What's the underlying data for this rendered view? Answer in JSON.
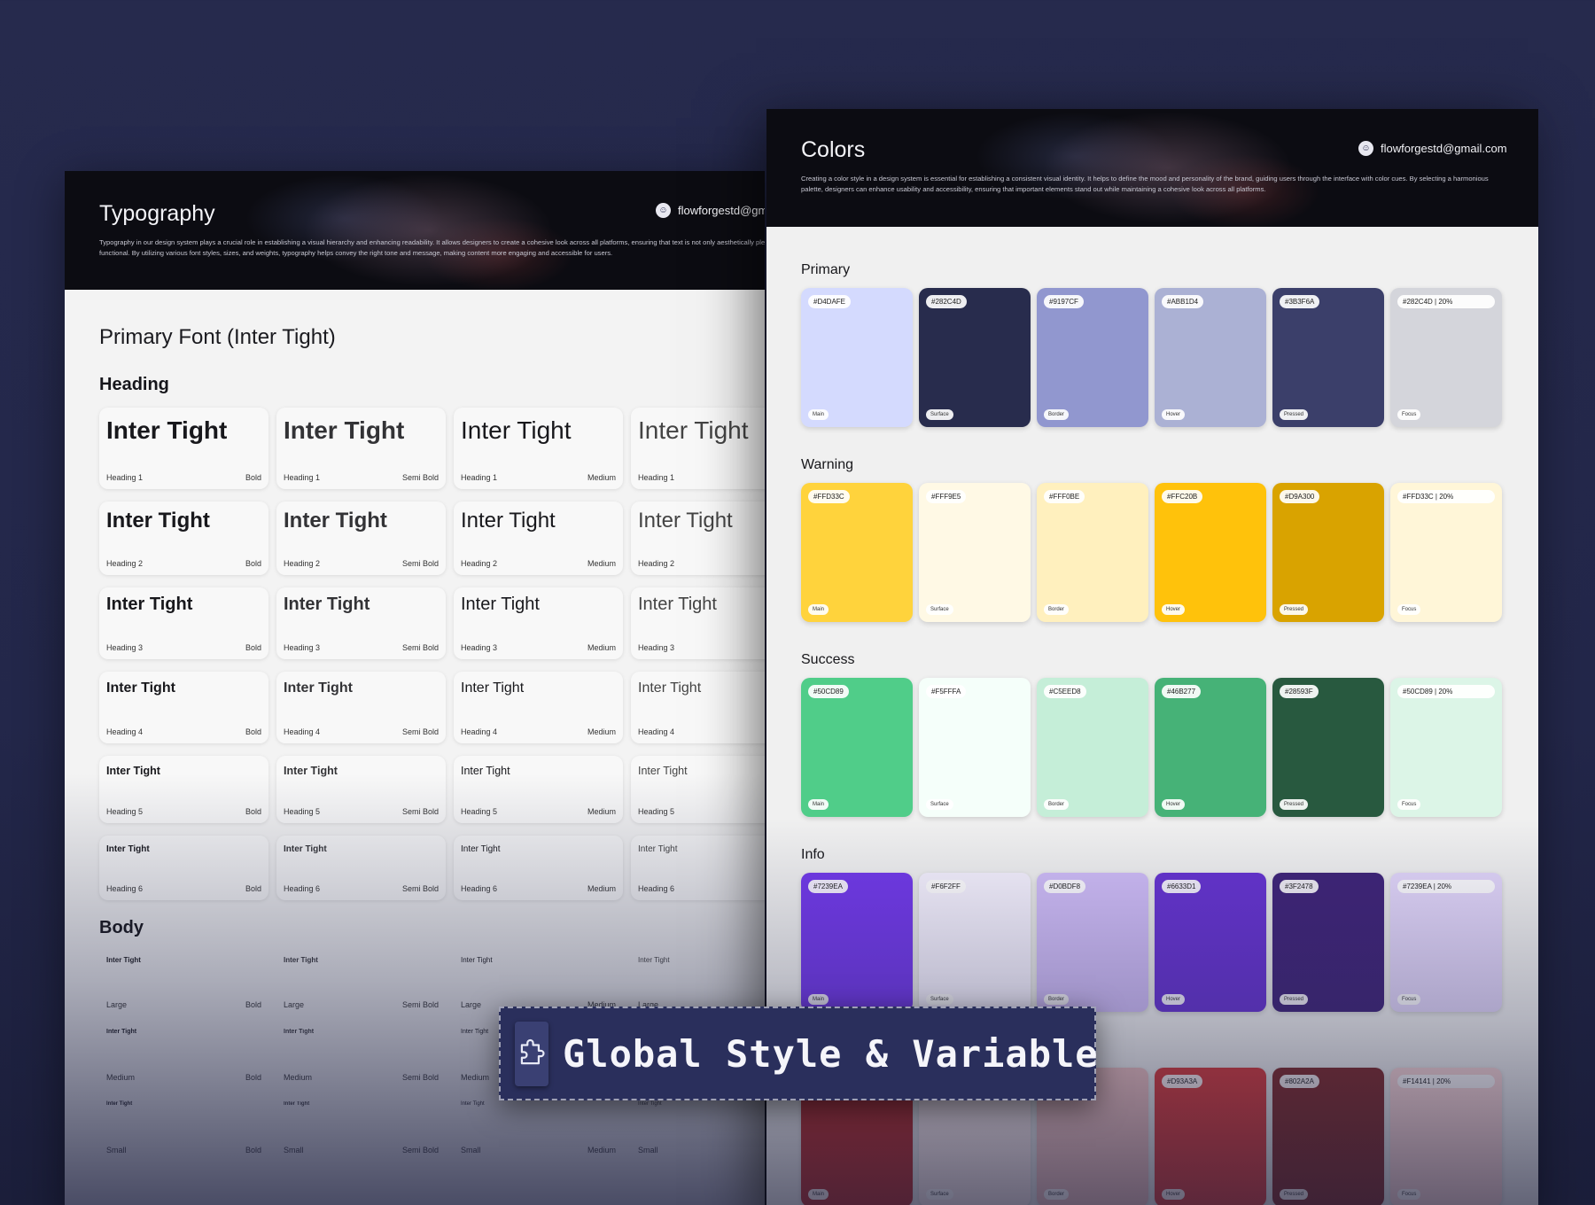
{
  "typography": {
    "title": "Typography",
    "email": "flowforgestd@gmail.com",
    "description": "Typography in our design system plays a crucial role in establishing a visual hierarchy and enhancing readability. It allows designers to create a cohesive look across all platforms, ensuring that text is not only aesthetically pleasing but also functional. By utilizing various font styles, sizes, and weights, typography helps convey the right tone and message, making content more engaging and accessible for users.",
    "font_title": "Primary Font (Inter Tight)",
    "heading_label": "Heading",
    "body_label": "Body",
    "sample": "Inter Tight",
    "weights": [
      "Bold",
      "Semi Bold",
      "Medium",
      ""
    ],
    "headings": [
      "Heading 1",
      "Heading 2",
      "Heading 3",
      "Heading 4",
      "Heading 5",
      "Heading 6"
    ],
    "body_sizes": [
      "Large",
      "Medium",
      "Small"
    ]
  },
  "colors": {
    "title": "Colors",
    "email": "flowforgestd@gmail.com",
    "description": "Creating a color style in a design system is essential for establishing a consistent visual identity. It helps to define the mood and personality of the brand, guiding users through the interface with color cues. By selecting a harmonious palette, designers can enhance usability and accessibility, ensuring that important elements stand out while maintaining a cohesive look across all platforms.",
    "roles": [
      "Main",
      "Surface",
      "Border",
      "Hover",
      "Pressed",
      "Focus"
    ],
    "groups": [
      {
        "name": "Primary",
        "swatches": [
          {
            "hex": "#D4DAFE",
            "color": "#D4DAFE"
          },
          {
            "hex": "#282C4D",
            "color": "#282C4D"
          },
          {
            "hex": "#9197CF",
            "color": "#9197CF"
          },
          {
            "hex": "#ABB1D4",
            "color": "#ABB1D4"
          },
          {
            "hex": "#3B3F6A",
            "color": "#3B3F6A"
          },
          {
            "hex": "#282C4D | 20%",
            "color": "#D4D5DB"
          }
        ]
      },
      {
        "name": "Warning",
        "swatches": [
          {
            "hex": "#FFD33C",
            "color": "#FFD33C"
          },
          {
            "hex": "#FFF9E5",
            "color": "#FFF9E5"
          },
          {
            "hex": "#FFF0BE",
            "color": "#FFF0BE"
          },
          {
            "hex": "#FFC20B",
            "color": "#FFC20B"
          },
          {
            "hex": "#D9A300",
            "color": "#D9A300"
          },
          {
            "hex": "#FFD33C | 20%",
            "color": "#FFF6D8"
          }
        ]
      },
      {
        "name": "Success",
        "swatches": [
          {
            "hex": "#50CD89",
            "color": "#50CD89"
          },
          {
            "hex": "#F5FFFA",
            "color": "#F5FFFA"
          },
          {
            "hex": "#C5EED8",
            "color": "#C5EED8"
          },
          {
            "hex": "#46B277",
            "color": "#46B277"
          },
          {
            "hex": "#28593F",
            "color": "#28593F"
          },
          {
            "hex": "#50CD89 | 20%",
            "color": "#DCF5E7"
          }
        ]
      },
      {
        "name": "Info",
        "swatches": [
          {
            "hex": "#7239EA",
            "color": "#7239EA"
          },
          {
            "hex": "#F6F2FF",
            "color": "#F6F2FF"
          },
          {
            "hex": "#D0BDF8",
            "color": "#D0BDF8"
          },
          {
            "hex": "#6633D1",
            "color": "#6633D1"
          },
          {
            "hex": "#3F2478",
            "color": "#3F2478"
          },
          {
            "hex": "#7239EA | 20%",
            "color": "#E3D7FB"
          }
        ]
      },
      {
        "name": "",
        "swatches": [
          {
            "hex": "",
            "color": "#B52A2A"
          },
          {
            "hex": "",
            "color": "#FBEDED"
          },
          {
            "hex": "",
            "color": "#EFC2C2"
          },
          {
            "hex": "#D93A3A",
            "color": "#D93A3A"
          },
          {
            "hex": "#802A2A",
            "color": "#802A2A"
          },
          {
            "hex": "#F14141 | 20%",
            "color": "#FCD9D9"
          }
        ]
      }
    ]
  },
  "banner": {
    "text": "Global Style & Variable",
    "icon": "puzzle-icon"
  }
}
